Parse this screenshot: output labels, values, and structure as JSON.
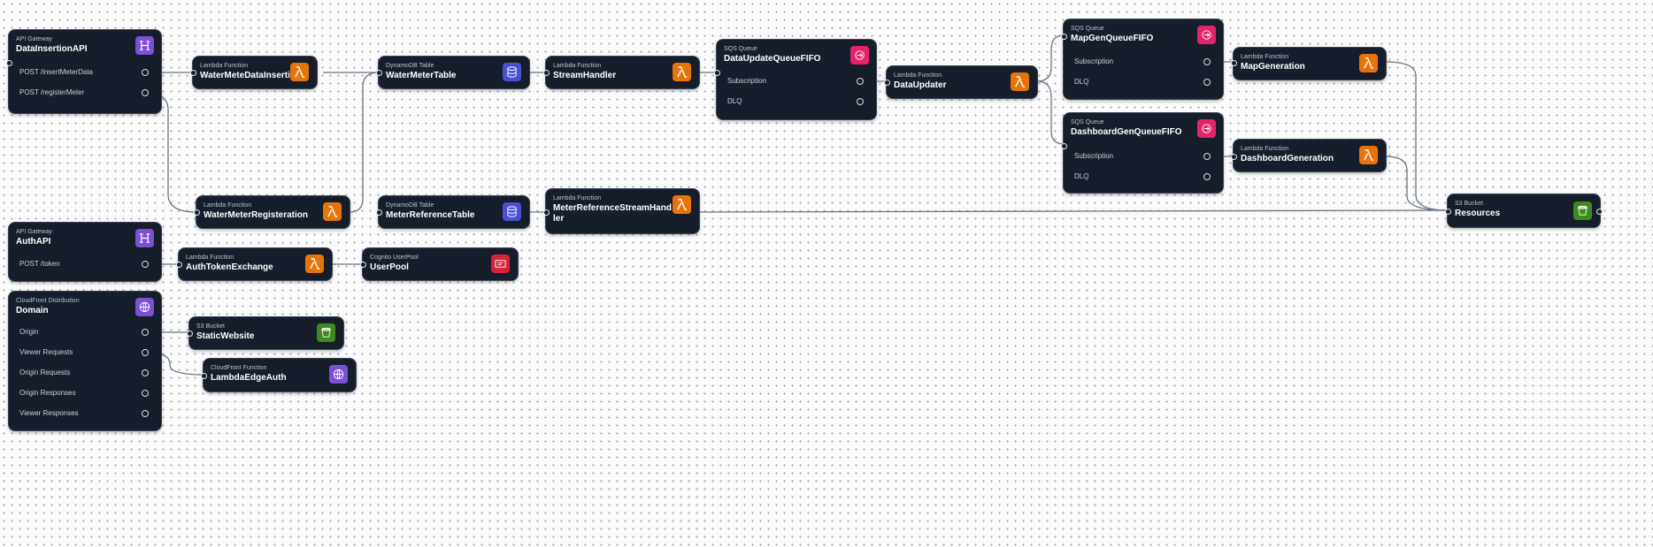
{
  "nodes": {
    "data_insertion_api": {
      "type": "API Gateway",
      "title": "DataInsertionAPI",
      "ports": [
        "POST /insertMeterData",
        "POST /registerMeter"
      ]
    },
    "water_mete_data_insertion": {
      "type": "Lambda Function",
      "title": "WaterMeteDataInsertion"
    },
    "water_meter_table": {
      "type": "DynamoDB Table",
      "title": "WaterMeterTable"
    },
    "stream_handler": {
      "type": "Lambda Function",
      "title": "StreamHandler"
    },
    "data_update_queue": {
      "type": "SQS Queue",
      "title": "DataUpdateQueueFIFO",
      "ports": [
        "Subscription",
        "DLQ"
      ]
    },
    "data_updater": {
      "type": "Lambda Function",
      "title": "DataUpdater"
    },
    "map_gen_queue": {
      "type": "SQS Queue",
      "title": "MapGenQueueFIFO",
      "ports": [
        "Subscription",
        "DLQ"
      ]
    },
    "map_generation": {
      "type": "Lambda Function",
      "title": "MapGeneration"
    },
    "dashboard_gen_queue": {
      "type": "SQS Queue",
      "title": "DashboardGenQueueFIFO",
      "ports": [
        "Subscription",
        "DLQ"
      ]
    },
    "dashboard_generation": {
      "type": "Lambda Function",
      "title": "DashboardGeneration"
    },
    "water_meter_registeration": {
      "type": "Lambda Function",
      "title": "WaterMeterRegisteration"
    },
    "meter_reference_table": {
      "type": "DynamoDB Table",
      "title": "MeterReferenceTable"
    },
    "meter_reference_stream_handler": {
      "type": "Lambda Function",
      "title_line1": "MeterReferenceStreamHand",
      "title_line2": "ler"
    },
    "resources": {
      "type": "S3 Bucket",
      "title": "Resources"
    },
    "auth_api": {
      "type": "API Gateway",
      "title": "AuthAPI",
      "ports": [
        "POST /token"
      ]
    },
    "auth_token_exchange": {
      "type": "Lambda Function",
      "title": "AuthTokenExchange"
    },
    "user_pool": {
      "type": "Cognito UserPool",
      "title": "UserPool"
    },
    "domain": {
      "type": "CloudFront Distribution",
      "title": "Domain",
      "ports": [
        "Origin",
        "Viewer Requests",
        "Origin Requests",
        "Origin Responses",
        "Viewer Responses"
      ]
    },
    "static_website": {
      "type": "S3 Bucket",
      "title": "StaticWebsite"
    },
    "lambda_edge_auth": {
      "type": "CloudFront Function",
      "title": "LambdaEdgeAuth"
    }
  },
  "colors": {
    "lambda": "#e8730a",
    "api_gateway": "#7b4fd6",
    "dynamodb": "#4b4fd1",
    "sqs": "#e3246b",
    "s3": "#3e8a1f",
    "cognito": "#d6223a",
    "cloudfront": "#7b4fd6",
    "node_bg": "#161e2b",
    "wire": "#6b7585"
  },
  "icons": {
    "lambda": "lambda-icon",
    "api_gateway": "api-gateway-icon",
    "dynamodb": "dynamodb-icon",
    "sqs": "sqs-icon",
    "s3": "s3-bucket-icon",
    "cognito": "cognito-icon",
    "cloudfront": "cloudfront-icon"
  }
}
